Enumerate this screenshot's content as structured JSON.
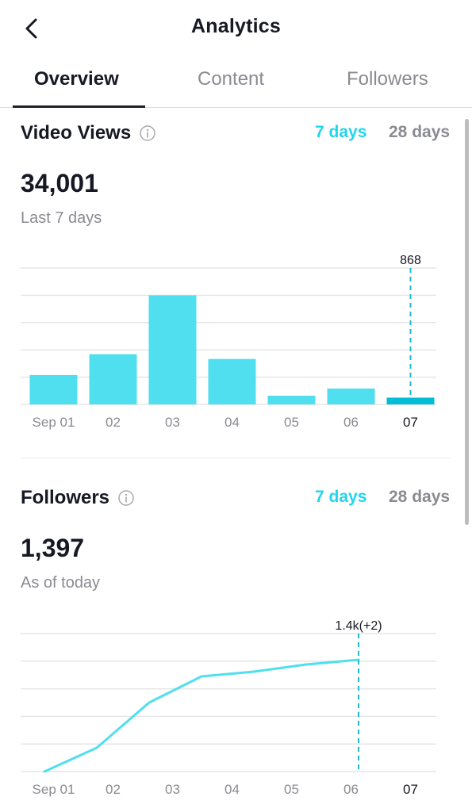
{
  "header": {
    "title": "Analytics",
    "back_icon": "chevron-left-icon"
  },
  "tabs": [
    {
      "label": "Overview",
      "active": true
    },
    {
      "label": "Content",
      "active": false
    },
    {
      "label": "Followers",
      "active": false
    }
  ],
  "colors": {
    "accent": "#20d5ec",
    "bar": "#4fdfef",
    "bar_selected": "#00bcd4",
    "text_primary": "#161823",
    "text_secondary": "#8a8b91",
    "grid": "#e6e6e6"
  },
  "video_views": {
    "title": "Video Views",
    "info_icon": "info-circle-icon",
    "range_options": [
      "7 days",
      "28 days"
    ],
    "selected_range": "7 days",
    "total": "34,001",
    "sub_label": "Last 7 days",
    "tooltip": "868"
  },
  "followers": {
    "title": "Followers",
    "info_icon": "info-circle-icon",
    "range_options": [
      "7 days",
      "28 days"
    ],
    "selected_range": "7 days",
    "total": "1,397",
    "sub_label": "As of today",
    "tooltip": "1.4k(+2)"
  },
  "chart_data": [
    {
      "type": "bar",
      "title": "Video Views",
      "categories": [
        "Sep 01",
        "02",
        "03",
        "04",
        "05",
        "06",
        "07"
      ],
      "values": [
        3770,
        6440,
        14000,
        5830,
        1120,
        2040,
        868
      ],
      "highlighted_index": 6,
      "highlight_label": "868",
      "ylim": [
        0,
        17500
      ],
      "grid": true,
      "xlabel": "",
      "ylabel": ""
    },
    {
      "type": "line",
      "title": "Followers",
      "categories": [
        "Sep 01",
        "02",
        "03",
        "04",
        "05",
        "06",
        "07"
      ],
      "values": [
        1350,
        1360,
        1379,
        1390,
        1392,
        1395,
        1397
      ],
      "highlighted_index": 6,
      "highlight_label": "1.4k(+2)",
      "ylim": [
        1350,
        1408
      ],
      "grid": true,
      "xlabel": "",
      "ylabel": ""
    }
  ]
}
